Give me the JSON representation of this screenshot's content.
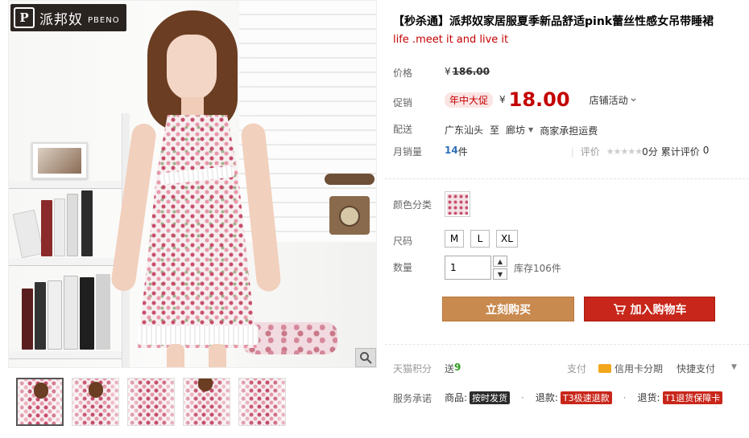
{
  "brand": {
    "mark": "P",
    "name_cn": "派邦奴",
    "name_en": "PBENO"
  },
  "product": {
    "title": "【秒杀通】派邦奴家居服夏季新品舒适pink蕾丝性感女吊带睡裙",
    "subtitle": "life .meet it and live it"
  },
  "price": {
    "label": "价格",
    "currency": "¥",
    "original": "186.00"
  },
  "promo": {
    "label": "促销",
    "tag": "年中大促",
    "currency": "¥",
    "price": "18.00",
    "activity": "店铺活动"
  },
  "shipping": {
    "label": "配送",
    "from": "广东汕头",
    "to_word": "至",
    "to": "廊坊",
    "fee": "商家承担运费"
  },
  "sales": {
    "label": "月销量",
    "count": "14",
    "unit": "件",
    "rating_label": "评价",
    "stars": "★★★★★",
    "score": "0分",
    "review_label": "累计评价",
    "review_count": "0"
  },
  "color": {
    "label": "颜色分类"
  },
  "size": {
    "label": "尺码",
    "options": [
      "M",
      "L",
      "XL"
    ]
  },
  "quantity": {
    "label": "数量",
    "value": "1",
    "stock": "库存106件"
  },
  "actions": {
    "buy": "立刻购买",
    "cart": "加入购物车"
  },
  "points": {
    "label": "天猫积分",
    "give": "送",
    "amount": "9"
  },
  "payment": {
    "label": "支付",
    "card": "信用卡分期",
    "quick": "快捷支付"
  },
  "service": {
    "label": "服务承诺",
    "items": [
      {
        "prefix": "商品:",
        "tag": "按时发货"
      },
      {
        "prefix": "退款:",
        "tag": "T3极速退款"
      },
      {
        "prefix": "退货:",
        "tag": "T1退货保障卡"
      }
    ]
  },
  "colors": {
    "accent_red": "#c40000",
    "buy": "#c98a4f",
    "cart": "#c8261a"
  }
}
